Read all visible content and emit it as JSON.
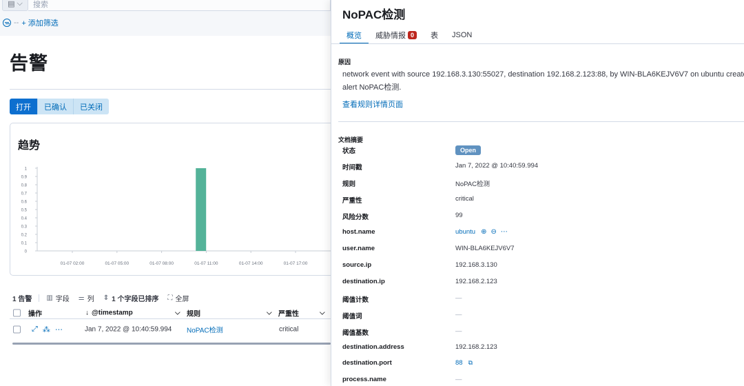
{
  "search": {
    "placeholder": "搜索",
    "add_filter": "+ 添加筛选"
  },
  "page": {
    "title": "告警",
    "status_buttons": [
      "打开",
      "已确认",
      "已关闭"
    ]
  },
  "trend": {
    "title": "趋势"
  },
  "chart_data": {
    "type": "bar",
    "x": [
      "01-07 02:00",
      "01-07 05:00",
      "01-07 08:00",
      "01-07 11:00",
      "01-07 14:00",
      "01-07 17:00"
    ],
    "x_tick_partial": "0",
    "y_ticks": [
      "0",
      "0.1",
      "0.2",
      "0.3",
      "0.4",
      "0.5",
      "0.6",
      "0.7",
      "0.8",
      "0.9",
      "1"
    ],
    "ylim": [
      0,
      1
    ],
    "series": [
      {
        "values": [
          {
            "x": "01-07 10:40",
            "y": 1
          }
        ]
      }
    ],
    "color": "#54b399",
    "grid": false
  },
  "toolbar": {
    "count": "1 告警",
    "fields": "字段",
    "columns": "列",
    "sorted": "1 个字段已排序",
    "fullscreen": "全屏"
  },
  "grid": {
    "headers": {
      "actions": "操作",
      "timestamp": "@timestamp",
      "rule": "规则",
      "severity": "严重性"
    },
    "rows": [
      {
        "timestamp": "Jan 7, 2022 @ 10:40:59.994",
        "rule": "NoPAC检测",
        "severity": "critical"
      }
    ]
  },
  "flyout": {
    "title": "NoPAC检测",
    "tabs": [
      {
        "label": "概览"
      },
      {
        "label": "威胁情报",
        "badge": "0"
      },
      {
        "label": "表"
      },
      {
        "label": "JSON"
      }
    ],
    "reason_header": "原因",
    "reason_line1": "network event with source 192.168.3.130:55027, destination 192.168.2.123:88, by WIN-BLA6KEJV6V7 on ubuntu created critical",
    "reason_line2": "alert NoPAC检测.",
    "rule_link": "查看规则详情页面",
    "summary_header": "文档摘要",
    "fields": [
      {
        "key": "状态",
        "value": "Open"
      },
      {
        "key": "时间戳",
        "value": "Jan 7, 2022 @ 10:40:59.994"
      },
      {
        "key": "规则",
        "value": "NoPAC检测"
      },
      {
        "key": "严重性",
        "value": "critical"
      },
      {
        "key": "风险分数",
        "value": "99"
      },
      {
        "key": "host.name",
        "value": "ubuntu"
      },
      {
        "key": "user.name",
        "value": "WIN-BLA6KEJV6V7"
      },
      {
        "key": "source.ip",
        "value": "192.168.3.130"
      },
      {
        "key": "destination.ip",
        "value": "192.168.2.123"
      },
      {
        "key": "阈值计数",
        "value": "—"
      },
      {
        "key": "阈值词",
        "value": "—"
      },
      {
        "key": "阈值基数",
        "value": "—"
      },
      {
        "key": "destination.address",
        "value": "192.168.2.123"
      },
      {
        "key": "destination.port",
        "value": "88"
      },
      {
        "key": "process.name",
        "value": "—"
      }
    ]
  }
}
